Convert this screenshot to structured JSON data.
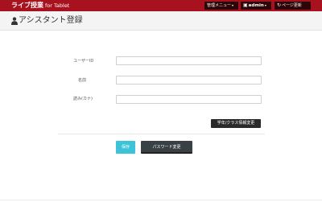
{
  "app": {
    "brand": "ライブ授業",
    "brand_sub": "for Tablet"
  },
  "nav": {
    "menu_label": "管理メニュー",
    "admin_label": "admin",
    "refresh_label": "ページ更新"
  },
  "page": {
    "title": "アシスタント登録"
  },
  "form": {
    "userid_label": "ユーザーID",
    "name_label": "名前",
    "reading_label": "読み(カナ)",
    "userid_value": "",
    "name_value": "",
    "reading_value": ""
  },
  "buttons": {
    "grade_class": "学年/クラス情報変更",
    "save": "保存",
    "password": "パスワード変更"
  },
  "colors": {
    "topbar": "#a8121e",
    "save": "#3cc3d8",
    "dark": "#3a4145"
  }
}
